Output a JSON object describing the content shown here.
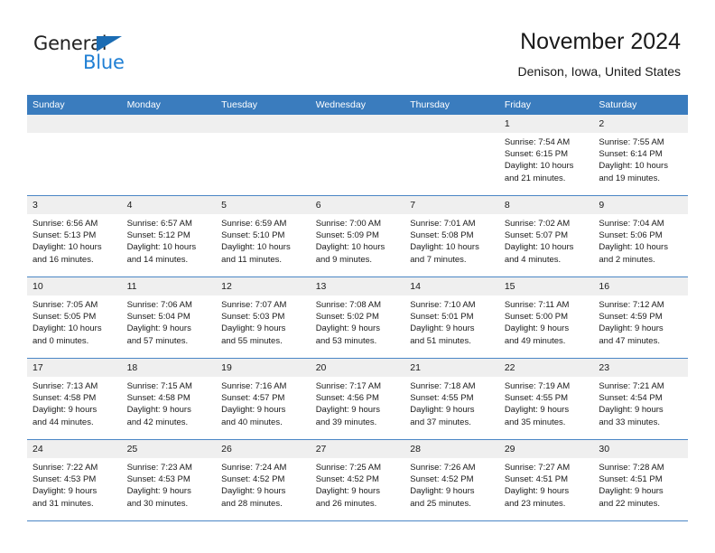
{
  "brand": {
    "name_part1": "General",
    "name_part2": "Blue",
    "triangle_icon": "triangle-icon",
    "accent_color": "#1f7fd4",
    "triangle_color": "#1b6cb3"
  },
  "header": {
    "title": "November 2024",
    "subtitle": "Denison, Iowa, United States"
  },
  "calendar": {
    "header_bg": "#3a7cbe",
    "daynum_bg": "#efefef",
    "row_border_color": "#4a86c5",
    "weekdays": [
      "Sunday",
      "Monday",
      "Tuesday",
      "Wednesday",
      "Thursday",
      "Friday",
      "Saturday"
    ],
    "weeks": [
      [
        {
          "day": "",
          "sunrise": "",
          "sunset": "",
          "daylight_line1": "",
          "daylight_line2": ""
        },
        {
          "day": "",
          "sunrise": "",
          "sunset": "",
          "daylight_line1": "",
          "daylight_line2": ""
        },
        {
          "day": "",
          "sunrise": "",
          "sunset": "",
          "daylight_line1": "",
          "daylight_line2": ""
        },
        {
          "day": "",
          "sunrise": "",
          "sunset": "",
          "daylight_line1": "",
          "daylight_line2": ""
        },
        {
          "day": "",
          "sunrise": "",
          "sunset": "",
          "daylight_line1": "",
          "daylight_line2": ""
        },
        {
          "day": "1",
          "sunrise": "Sunrise: 7:54 AM",
          "sunset": "Sunset: 6:15 PM",
          "daylight_line1": "Daylight: 10 hours",
          "daylight_line2": "and 21 minutes."
        },
        {
          "day": "2",
          "sunrise": "Sunrise: 7:55 AM",
          "sunset": "Sunset: 6:14 PM",
          "daylight_line1": "Daylight: 10 hours",
          "daylight_line2": "and 19 minutes."
        }
      ],
      [
        {
          "day": "3",
          "sunrise": "Sunrise: 6:56 AM",
          "sunset": "Sunset: 5:13 PM",
          "daylight_line1": "Daylight: 10 hours",
          "daylight_line2": "and 16 minutes."
        },
        {
          "day": "4",
          "sunrise": "Sunrise: 6:57 AM",
          "sunset": "Sunset: 5:12 PM",
          "daylight_line1": "Daylight: 10 hours",
          "daylight_line2": "and 14 minutes."
        },
        {
          "day": "5",
          "sunrise": "Sunrise: 6:59 AM",
          "sunset": "Sunset: 5:10 PM",
          "daylight_line1": "Daylight: 10 hours",
          "daylight_line2": "and 11 minutes."
        },
        {
          "day": "6",
          "sunrise": "Sunrise: 7:00 AM",
          "sunset": "Sunset: 5:09 PM",
          "daylight_line1": "Daylight: 10 hours",
          "daylight_line2": "and 9 minutes."
        },
        {
          "day": "7",
          "sunrise": "Sunrise: 7:01 AM",
          "sunset": "Sunset: 5:08 PM",
          "daylight_line1": "Daylight: 10 hours",
          "daylight_line2": "and 7 minutes."
        },
        {
          "day": "8",
          "sunrise": "Sunrise: 7:02 AM",
          "sunset": "Sunset: 5:07 PM",
          "daylight_line1": "Daylight: 10 hours",
          "daylight_line2": "and 4 minutes."
        },
        {
          "day": "9",
          "sunrise": "Sunrise: 7:04 AM",
          "sunset": "Sunset: 5:06 PM",
          "daylight_line1": "Daylight: 10 hours",
          "daylight_line2": "and 2 minutes."
        }
      ],
      [
        {
          "day": "10",
          "sunrise": "Sunrise: 7:05 AM",
          "sunset": "Sunset: 5:05 PM",
          "daylight_line1": "Daylight: 10 hours",
          "daylight_line2": "and 0 minutes."
        },
        {
          "day": "11",
          "sunrise": "Sunrise: 7:06 AM",
          "sunset": "Sunset: 5:04 PM",
          "daylight_line1": "Daylight: 9 hours",
          "daylight_line2": "and 57 minutes."
        },
        {
          "day": "12",
          "sunrise": "Sunrise: 7:07 AM",
          "sunset": "Sunset: 5:03 PM",
          "daylight_line1": "Daylight: 9 hours",
          "daylight_line2": "and 55 minutes."
        },
        {
          "day": "13",
          "sunrise": "Sunrise: 7:08 AM",
          "sunset": "Sunset: 5:02 PM",
          "daylight_line1": "Daylight: 9 hours",
          "daylight_line2": "and 53 minutes."
        },
        {
          "day": "14",
          "sunrise": "Sunrise: 7:10 AM",
          "sunset": "Sunset: 5:01 PM",
          "daylight_line1": "Daylight: 9 hours",
          "daylight_line2": "and 51 minutes."
        },
        {
          "day": "15",
          "sunrise": "Sunrise: 7:11 AM",
          "sunset": "Sunset: 5:00 PM",
          "daylight_line1": "Daylight: 9 hours",
          "daylight_line2": "and 49 minutes."
        },
        {
          "day": "16",
          "sunrise": "Sunrise: 7:12 AM",
          "sunset": "Sunset: 4:59 PM",
          "daylight_line1": "Daylight: 9 hours",
          "daylight_line2": "and 47 minutes."
        }
      ],
      [
        {
          "day": "17",
          "sunrise": "Sunrise: 7:13 AM",
          "sunset": "Sunset: 4:58 PM",
          "daylight_line1": "Daylight: 9 hours",
          "daylight_line2": "and 44 minutes."
        },
        {
          "day": "18",
          "sunrise": "Sunrise: 7:15 AM",
          "sunset": "Sunset: 4:58 PM",
          "daylight_line1": "Daylight: 9 hours",
          "daylight_line2": "and 42 minutes."
        },
        {
          "day": "19",
          "sunrise": "Sunrise: 7:16 AM",
          "sunset": "Sunset: 4:57 PM",
          "daylight_line1": "Daylight: 9 hours",
          "daylight_line2": "and 40 minutes."
        },
        {
          "day": "20",
          "sunrise": "Sunrise: 7:17 AM",
          "sunset": "Sunset: 4:56 PM",
          "daylight_line1": "Daylight: 9 hours",
          "daylight_line2": "and 39 minutes."
        },
        {
          "day": "21",
          "sunrise": "Sunrise: 7:18 AM",
          "sunset": "Sunset: 4:55 PM",
          "daylight_line1": "Daylight: 9 hours",
          "daylight_line2": "and 37 minutes."
        },
        {
          "day": "22",
          "sunrise": "Sunrise: 7:19 AM",
          "sunset": "Sunset: 4:55 PM",
          "daylight_line1": "Daylight: 9 hours",
          "daylight_line2": "and 35 minutes."
        },
        {
          "day": "23",
          "sunrise": "Sunrise: 7:21 AM",
          "sunset": "Sunset: 4:54 PM",
          "daylight_line1": "Daylight: 9 hours",
          "daylight_line2": "and 33 minutes."
        }
      ],
      [
        {
          "day": "24",
          "sunrise": "Sunrise: 7:22 AM",
          "sunset": "Sunset: 4:53 PM",
          "daylight_line1": "Daylight: 9 hours",
          "daylight_line2": "and 31 minutes."
        },
        {
          "day": "25",
          "sunrise": "Sunrise: 7:23 AM",
          "sunset": "Sunset: 4:53 PM",
          "daylight_line1": "Daylight: 9 hours",
          "daylight_line2": "and 30 minutes."
        },
        {
          "day": "26",
          "sunrise": "Sunrise: 7:24 AM",
          "sunset": "Sunset: 4:52 PM",
          "daylight_line1": "Daylight: 9 hours",
          "daylight_line2": "and 28 minutes."
        },
        {
          "day": "27",
          "sunrise": "Sunrise: 7:25 AM",
          "sunset": "Sunset: 4:52 PM",
          "daylight_line1": "Daylight: 9 hours",
          "daylight_line2": "and 26 minutes."
        },
        {
          "day": "28",
          "sunrise": "Sunrise: 7:26 AM",
          "sunset": "Sunset: 4:52 PM",
          "daylight_line1": "Daylight: 9 hours",
          "daylight_line2": "and 25 minutes."
        },
        {
          "day": "29",
          "sunrise": "Sunrise: 7:27 AM",
          "sunset": "Sunset: 4:51 PM",
          "daylight_line1": "Daylight: 9 hours",
          "daylight_line2": "and 23 minutes."
        },
        {
          "day": "30",
          "sunrise": "Sunrise: 7:28 AM",
          "sunset": "Sunset: 4:51 PM",
          "daylight_line1": "Daylight: 9 hours",
          "daylight_line2": "and 22 minutes."
        }
      ]
    ]
  }
}
